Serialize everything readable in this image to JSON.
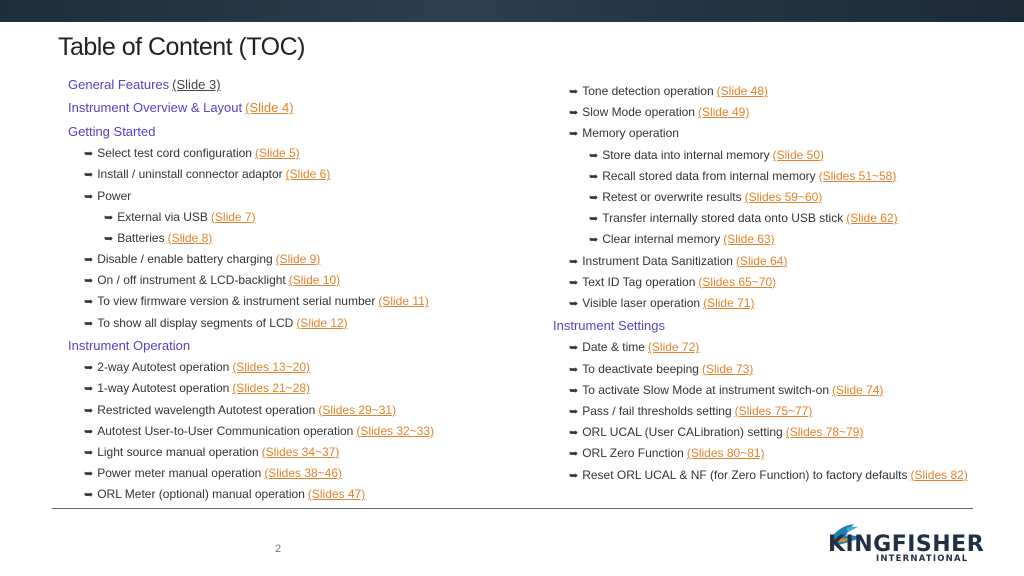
{
  "title": "Table of Content (TOC)",
  "colors": {
    "heading": "#5b3fc4",
    "link": "#e3832c",
    "text": "#333333"
  },
  "left_column": [
    {
      "level": "head",
      "text": "General Features",
      "link": "(Slide 3)",
      "link_style": "plain"
    },
    {
      "level": "head",
      "text": "Instrument Overview & Layout",
      "link": "(Slide 4)"
    },
    {
      "level": "head",
      "text": "Getting Started",
      "link": ""
    },
    {
      "level": "1",
      "text": "Select test cord configuration",
      "link": "(Slide 5)"
    },
    {
      "level": "1",
      "text": "Install / uninstall connector adaptor",
      "link": "(Slide 6)"
    },
    {
      "level": "1",
      "text": "Power",
      "link": ""
    },
    {
      "level": "2",
      "text": "External via USB",
      "link": "(Slide 7)"
    },
    {
      "level": "2",
      "text": "Batteries",
      "link": "(Slide 8)"
    },
    {
      "level": "1",
      "text": "Disable / enable battery charging",
      "link": "(Slide 9)"
    },
    {
      "level": "1",
      "text": "On / off instrument & LCD-backlight",
      "link": "(Slide 10)"
    },
    {
      "level": "1",
      "text": "To view firmware version & instrument serial number",
      "link": "(Slide 11)"
    },
    {
      "level": "1",
      "text": "To show all display segments of LCD",
      "link": "(Slide 12)"
    },
    {
      "level": "head",
      "text": "Instrument Operation",
      "link": ""
    },
    {
      "level": "1",
      "text": "2-way Autotest operation",
      "link": "(Slides 13~20)"
    },
    {
      "level": "1",
      "text": "1-way Autotest operation",
      "link": "(Slides 21~28)"
    },
    {
      "level": "1",
      "text": "Restricted wavelength Autotest operation",
      "link": "(Slides 29~31)"
    },
    {
      "level": "1",
      "text": "Autotest User-to-User Communication  operation",
      "link": "(Slides 32~33)"
    },
    {
      "level": "1",
      "text": "Light source manual operation",
      "link": "(Slides 34~37)"
    },
    {
      "level": "1",
      "text": "Power meter manual operation",
      "link": "(Slides 38~46)"
    },
    {
      "level": "1",
      "text": "ORL Meter (optional) manual operation",
      "link": "(Slides 47)"
    }
  ],
  "right_column": [
    {
      "level": "1",
      "text": "Tone detection operation",
      "link": "(Slide 48)"
    },
    {
      "level": "1",
      "text": "Slow Mode operation",
      "link": "(Slide 49)"
    },
    {
      "level": "1",
      "text": "Memory operation",
      "link": ""
    },
    {
      "level": "2",
      "text": "Store data into internal memory",
      "link": "(Slide 50)"
    },
    {
      "level": "2",
      "text": "Recall stored data from internal memory",
      "link": "(Slides 51~58)"
    },
    {
      "level": "2",
      "text": "Retest or overwrite results",
      "link": "(Slides 59~60)"
    },
    {
      "level": "2",
      "text": "Transfer internally stored data onto USB stick",
      "link": "(Slide 62)"
    },
    {
      "level": "2",
      "text": "Clear internal memory",
      "link": "(Slide 63)"
    },
    {
      "level": "1",
      "text": "Instrument Data Sanitization",
      "link": "(Slide 64)"
    },
    {
      "level": "1",
      "text": "Text ID Tag operation",
      "link": "(Slides 65~70)"
    },
    {
      "level": "1",
      "text": "Visible laser operation",
      "link": "(Slide 71)"
    },
    {
      "level": "head",
      "text": "Instrument Settings",
      "link": ""
    },
    {
      "level": "1",
      "text": "Date & time",
      "link": "(Slide 72)"
    },
    {
      "level": "1",
      "text": "To deactivate beeping",
      "link": "(Slide 73)"
    },
    {
      "level": "1",
      "text": "To activate Slow Mode at instrument switch-on",
      "link": "(Slide 74)"
    },
    {
      "level": "1",
      "text": "Pass / fail thresholds setting",
      "link": "(Slides 75~77)"
    },
    {
      "level": "1",
      "text": "ORL UCAL (User CALibration) setting",
      "link": "(Slides 78~79)"
    },
    {
      "level": "1",
      "text": "ORL Zero Function",
      "link": "(Slides 80~81)"
    },
    {
      "level": "1",
      "text": "Reset ORL UCAL & NF (for Zero Function) to factory defaults",
      "link": "(Slides 82)"
    }
  ],
  "page_number": "2",
  "logo": {
    "word": "KINGFISHER",
    "sub": "INTERNATIONAL",
    "icon": "kingfisher-bird-icon"
  }
}
